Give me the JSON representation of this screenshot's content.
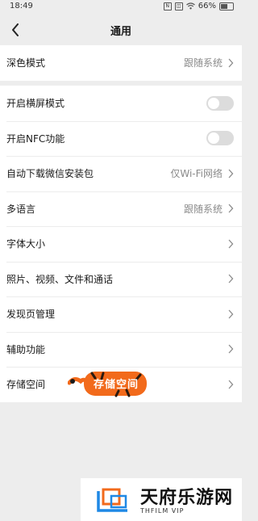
{
  "status": {
    "time": "18:49",
    "battery": "66%",
    "battery_level": 0.66
  },
  "nav": {
    "title": "通用"
  },
  "groups": [
    {
      "items": [
        {
          "label": "深色模式",
          "value": "跟随系统",
          "control": "chevron"
        }
      ]
    },
    {
      "items": [
        {
          "label": "开启横屏模式",
          "control": "toggle",
          "state": "off"
        },
        {
          "label": "开启NFC功能",
          "control": "toggle",
          "state": "off"
        },
        {
          "label": "自动下载微信安装包",
          "value": "仅Wi-Fi网络",
          "control": "chevron"
        },
        {
          "label": "多语言",
          "value": "跟随系统",
          "control": "chevron"
        },
        {
          "label": "字体大小",
          "control": "chevron"
        },
        {
          "label": "照片、视频、文件和通话",
          "control": "chevron"
        },
        {
          "label": "发现页管理",
          "control": "chevron"
        },
        {
          "label": "辅助功能",
          "control": "chevron"
        },
        {
          "label": "存储空间",
          "control": "chevron"
        }
      ]
    }
  ],
  "annotation": {
    "text": "存储空间",
    "color": "#f26a1b"
  },
  "watermark": {
    "text": "天府乐游网",
    "subtext": "THFILM VIP"
  }
}
